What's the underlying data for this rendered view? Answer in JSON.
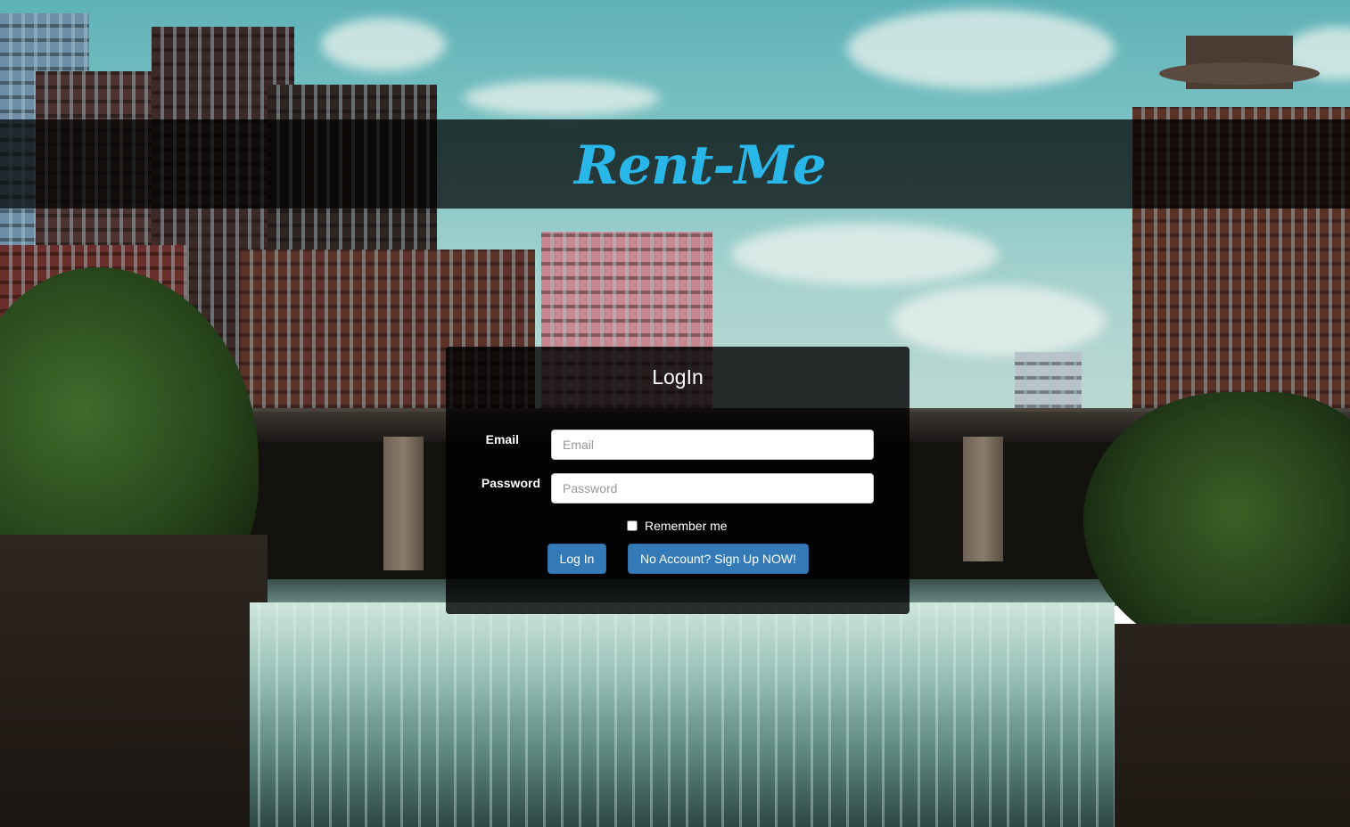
{
  "header": {
    "brand": "Rent-Me",
    "brand_color": "#29b6e8"
  },
  "login": {
    "title": "LogIn",
    "email_label": "Email",
    "email_placeholder": "Email",
    "email_value": "",
    "password_label": "Password",
    "password_placeholder": "Password",
    "password_value": "",
    "remember_label": "Remember me",
    "remember_checked": false,
    "login_button": "Log In",
    "signup_button": "No Account? Sign Up NOW!",
    "button_color": "#337ab7"
  }
}
